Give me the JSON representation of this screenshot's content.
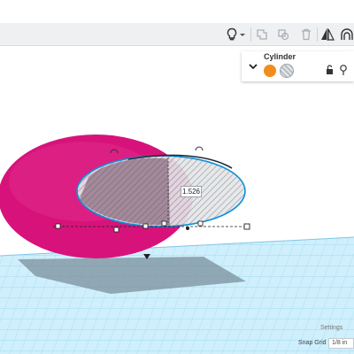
{
  "shape_panel": {
    "title": "Cylinder",
    "solid_color": "#f28c1c",
    "hole_label": "Hole"
  },
  "dimension": {
    "value": "1.526"
  },
  "footer": {
    "settings_label": "Settings",
    "snap_grid_label": "Snap Grid",
    "snap_grid_value": "1/8 in"
  },
  "colors": {
    "workplane": "#cfeffc",
    "grid_line": "#8fd3f0",
    "magenta_shape": "#d7137b",
    "selection_outline": "#0f8fd8",
    "toolbar_bg": "#eef0f2"
  },
  "toolbar": {
    "icons": [
      "lightbulb-icon",
      "copy-icon",
      "duplicate-icon",
      "delete-icon",
      "mirror-icon",
      "group-icon"
    ]
  }
}
